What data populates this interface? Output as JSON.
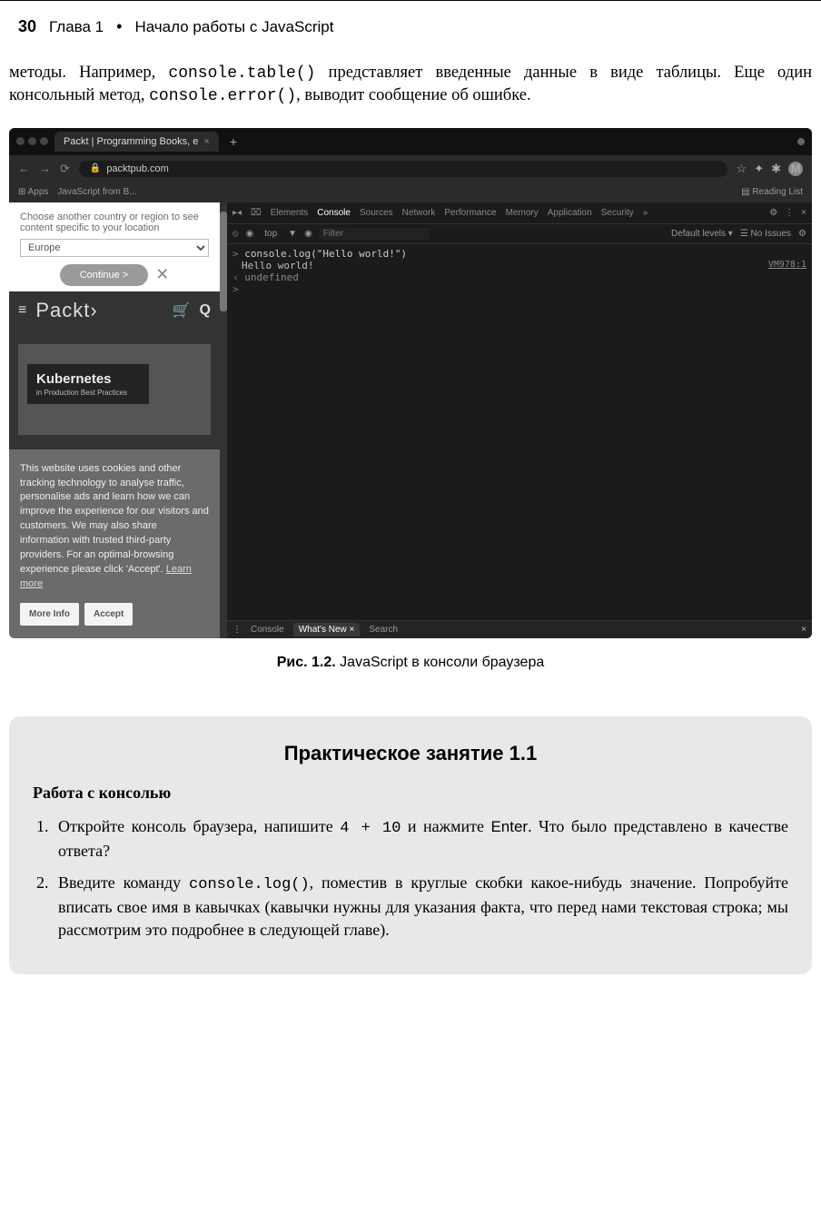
{
  "header": {
    "page_number": "30",
    "chapter_label": "Глава 1",
    "bullet": "•",
    "chapter_title": "Начало работы с JavaScript"
  },
  "body": {
    "p1_a": "методы. Например, ",
    "p1_code1": "console.table()",
    "p1_b": " представляет введенные данные в виде таблицы. Еще один консольный метод, ",
    "p1_code2": "console.error()",
    "p1_c": ", выводит сообщение об ошибке."
  },
  "browser": {
    "tab_title": "Packt | Programming Books, e",
    "tab_close": "×",
    "plus": "+",
    "back": "←",
    "forward": "→",
    "reload": "⟳",
    "lock": "🔒",
    "url": "packtpub.com",
    "star": "☆",
    "ext": "✦",
    "puzzle": "✱",
    "avatar": "M",
    "apps_label": "Apps",
    "bookmark1": "JavaScript from B...",
    "reading_list": "Reading List"
  },
  "site": {
    "region_prompt": "Choose another country or region to see content specific to your location",
    "region_value": "Europe",
    "continue": "Continue >",
    "close": "✕",
    "hamburger": "≡",
    "logo": "Packt›",
    "cart": "🛒",
    "search": "Q",
    "book_title": "Kubernetes",
    "book_sub": "in Production Best Practices",
    "cookies_a": "This website uses cookies and other tracking technology to analyse traffic, personalise ads and learn how we can improve the experience for our visitors and customers. We may also share information with trusted third-party providers. For an optimal-browsing experience please click 'Accept'. ",
    "learn_more": "Learn more",
    "more_info": "More Info",
    "accept": "Accept"
  },
  "devtools": {
    "inspect": "▸◂",
    "device": "⌧",
    "tabs": {
      "elements": "Elements",
      "console": "Console",
      "sources": "Sources",
      "network": "Network",
      "performance": "Performance",
      "memory": "Memory",
      "application": "Application",
      "security": "Security",
      "more": "»"
    },
    "gear": "⚙",
    "menu": "⋮",
    "close": "×",
    "toolbar": {
      "clear": "⦸",
      "eye": "◉",
      "context": "top",
      "dropdown": "▼",
      "eye2": "◉",
      "filter": "Filter",
      "levels": "Default levels ▾",
      "issues": "☰ No Issues",
      "gear": "⚙"
    },
    "line1_prompt": "> ",
    "line1": "console.log(\"Hello world!\")",
    "line2": "Hello world!",
    "line2_source": "VM978:1",
    "line3_prompt": "‹ ",
    "line3": "undefined",
    "line4_prompt": "> ",
    "bottom": {
      "menu": "⋮",
      "console": "Console",
      "whatsnew": "What's New",
      "dot": "×",
      "search": "Search",
      "close": "×"
    }
  },
  "caption": {
    "label": "Рис. 1.2.",
    "text": " JavaScript в консоли браузера"
  },
  "exercise": {
    "title": "Практическое занятие 1.1",
    "subtitle": "Работа с консолью",
    "item1_a": "Откройте консоль браузера, напишите ",
    "item1_code": "4 + 10",
    "item1_b": " и нажмите ",
    "item1_enter": "Enter",
    "item1_c": ". Что было представлено в качестве ответа?",
    "item2_a": "Введите команду ",
    "item2_code": "console.log()",
    "item2_b": ", поместив в круглые скобки какое-нибудь значение. Попробуйте вписать свое имя в кавычках (кавычки нужны для указания факта, что перед нами текстовая строка; мы рассмотрим это подробнее в следующей главе)."
  }
}
